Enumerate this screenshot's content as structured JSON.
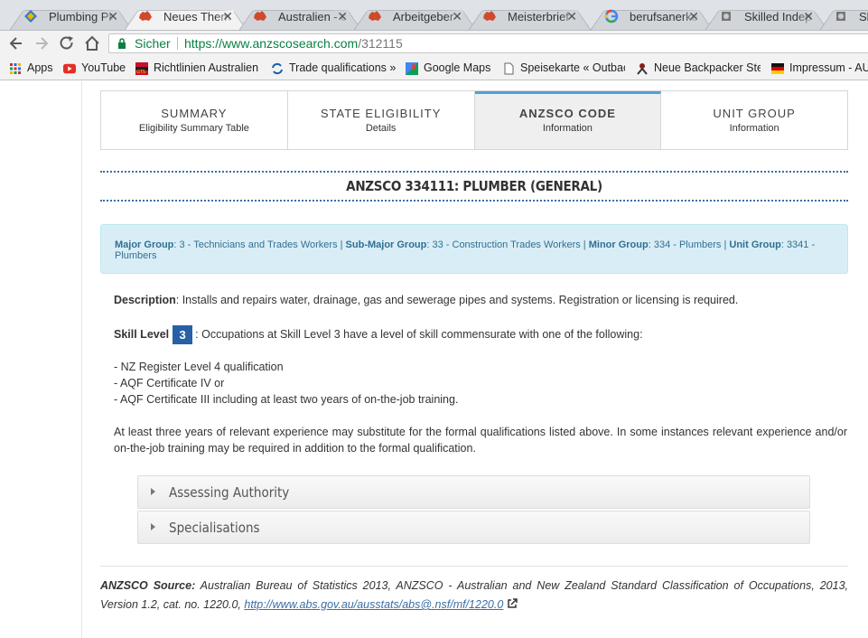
{
  "browser": {
    "tabs": [
      {
        "title": "Plumbing Pr",
        "icon": "diamond-favicon-icon"
      },
      {
        "title": "Neues Them",
        "icon": "australia-map-favicon-icon"
      },
      {
        "title": "Australien - c",
        "icon": "australia-map-favicon-icon"
      },
      {
        "title": "Arbeitgeber",
        "icon": "australia-map-favicon-icon"
      },
      {
        "title": "Meisterbrief",
        "icon": "australia-map-favicon-icon"
      },
      {
        "title": "berufsanerke",
        "icon": "google-favicon-icon"
      },
      {
        "title": "Skilled Indep",
        "icon": "coat-of-arms-favicon-icon"
      },
      {
        "title": "Ski",
        "icon": "coat-of-arms-favicon-icon"
      }
    ],
    "active_tab": 1,
    "secure_label": "Sicher",
    "url_base": "https://www.anzscosearch.com",
    "url_path": "/312115",
    "bookmarks": [
      {
        "label": "Apps",
        "icon": "apps-grid-icon"
      },
      {
        "label": "YouTube",
        "icon": "youtube-icon"
      },
      {
        "label": "Richtlinien Australien",
        "icon": "flag-icon"
      },
      {
        "label": "Trade qualifications »",
        "icon": "refresh-logo-icon"
      },
      {
        "label": "Google Maps",
        "icon": "google-maps-icon"
      },
      {
        "label": "Speisekarte « Outback",
        "icon": "document-icon"
      },
      {
        "label": "Neue Backpacker Steu",
        "icon": "person-icon"
      },
      {
        "label": "Impressum - AU",
        "icon": "german-flag-icon"
      }
    ]
  },
  "page": {
    "tabs": [
      {
        "title": "SUMMARY",
        "subtitle": "Eligibility Summary Table"
      },
      {
        "title": "STATE ELIGIBILITY",
        "subtitle": "Details"
      },
      {
        "title": "ANZSCO CODE",
        "subtitle": "Information"
      },
      {
        "title": "UNIT GROUP",
        "subtitle": "Information"
      }
    ],
    "active_tab": 2,
    "heading": "ANZSCO 334111: PLUMBER (GENERAL)",
    "groups": {
      "major_label": "Major Group",
      "major_value": ": 3 - Technicians and Trades Workers | ",
      "submajor_label": "Sub-Major Group",
      "submajor_value": ": 33 - Construction Trades Workers | ",
      "minor_label": "Minor Group",
      "minor_value": ": 334 - Plumbers | ",
      "unit_label": "Unit Group",
      "unit_value": ": 3341 - Plumbers"
    },
    "description_label": "Description",
    "description_text": ": Installs and repairs water, drainage, gas and sewerage pipes and systems. Registration or licensing is required.",
    "skill_label": "Skill Level",
    "skill_value": "3",
    "skill_text": ": Occupations at Skill Level 3 have a level of skill commensurate with one of the following:",
    "qualifications": [
      "- NZ Register Level 4 qualification",
      "- AQF Certificate IV or",
      "- AQF Certificate III including at least two years of on-the-job training."
    ],
    "experience_text": "At least three years of relevant experience may substitute for the formal qualifications listed above. In some instances relevant experience and/or on-the-job training may be required in addition to the formal qualification.",
    "accordions": [
      "Assessing Authority",
      "Specialisations"
    ],
    "source_label": "ANZSCO Source:",
    "source_text": " Australian Bureau of Statistics 2013, ANZSCO - Australian and New Zealand Standard Classification of Occupations, 2013, Version 1.2, cat. no. 1220.0, ",
    "source_link": "http://www.abs.gov.au/ausstats/abs@.nsf/mf/1220.0"
  }
}
